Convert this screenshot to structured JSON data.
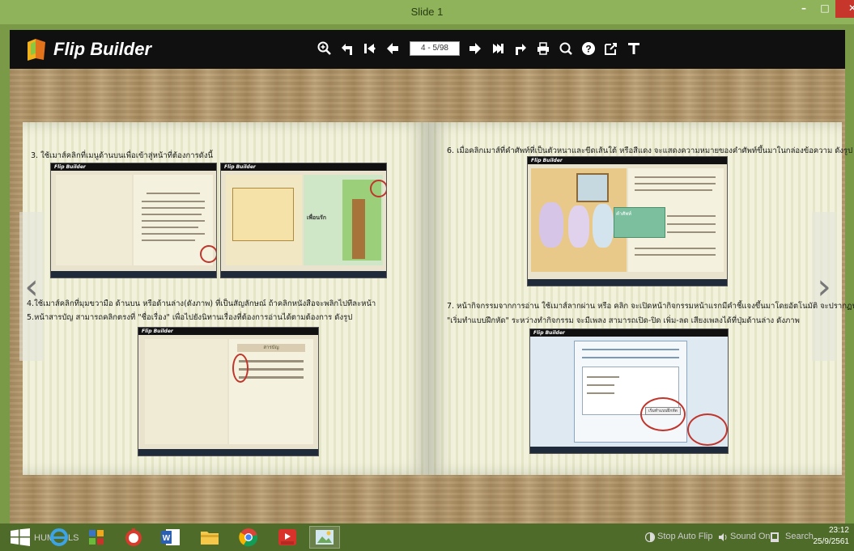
{
  "window": {
    "title": "Slide 1"
  },
  "toolbar": {
    "brand": "Flip Builder",
    "page_indicator": "4 - 5/98",
    "icons": [
      "zoom-in-icon",
      "back-icon",
      "first-page-icon",
      "prev-page-icon",
      "next-page-icon",
      "last-page-icon",
      "share-icon",
      "print-icon",
      "search-icon",
      "help-icon",
      "export-icon",
      "text-icon"
    ]
  },
  "left_page": {
    "step3": "3. ใช้เมาส์คลิกที่เมนูด้านบนเพื่อเข้าสู่หน้าที่ต้องการดังนี้",
    "step4": "4.ใช้เมาส์คลิกที่มุมขวามือ ด้านบน หรือด้านล่าง(ดังภาพ) ที่เป็นสัญลักษณ์ ถ้าคลิกหนังสือจะพลิกไปทีละหน้า",
    "step5": "5.หน้าสารบัญ สามารถคลิกตรงที่ \"ชื่อเรื่อง\" เพื่อไปยังนิทานเรื่องที่ต้องการอ่านได้ตามต้องการ ดังรูป"
  },
  "right_page": {
    "step6": "6. เมื่อคลิกเมาส์ที่คำศัพท์ที่เป็นตัวหนาและขีดเส้นใต้ หรือสีแดง จะแสดงความหมายของคำศัพท์ขึ้นมาในกล่องข้อความ ดังรูป",
    "step7a": "7. หน้ากิจกรรมจากการอ่าน ใช้เมาส์ลากผ่าน หรือ คลิก จะเปิดหน้ากิจกรรมหน้าแรกมีคำชี้แจงขึ้นมาโดยอัตโนมัติ จะปรากฏปุ่ม",
    "step7b": "\"เริ่มทำแบบฝึกหัด\" ระหว่างทำกิจกรรม จะมีเพลง สามารถเปิด-ปิด เพิ่ม-ลด เสียงเพลงได้ที่ปุ่มด้านล่าง ดังภาพ"
  },
  "mini_shots": {
    "brand": "Flip Builder",
    "toc_title": "สารบัญ",
    "exercise_button": "เริ่มทำแบบฝึกหัด",
    "popup_title": "คำศัพท์",
    "story_title": "เพื่อนรัก"
  },
  "taskbar": {
    "labels": [
      "HUM",
      "LS"
    ],
    "stop_flip": "Stop Auto Flip",
    "sound": "Sound On",
    "search": "Search",
    "time": "23:12",
    "date": "25/9/2561"
  },
  "colors": {
    "titlebar": "#8fb35b",
    "toolbar": "#101010",
    "close": "#c7362b",
    "taskbar": "#4f6b2a"
  }
}
